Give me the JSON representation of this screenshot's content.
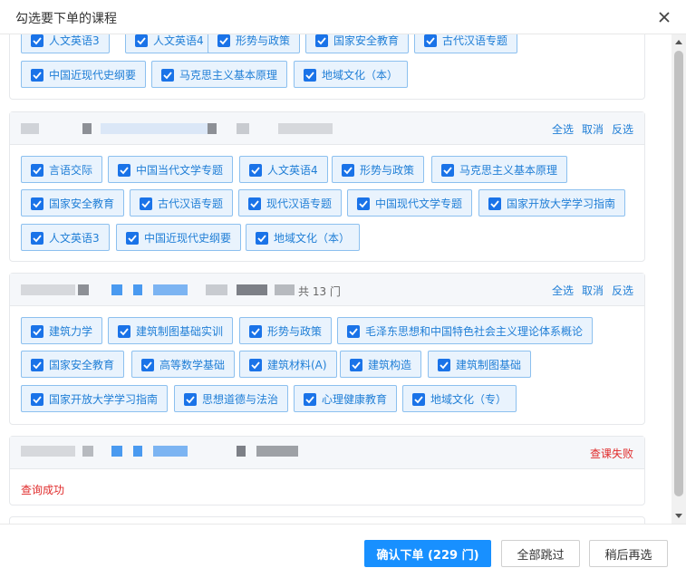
{
  "dialog": {
    "title": "勾选要下单的课程",
    "close_icon": "close-icon"
  },
  "section1": {
    "chips": [
      "人文英语3",
      "人文英语4",
      "形势与政策",
      "国家安全教育",
      "古代汉语专题",
      "中国近现代史纲要",
      "马克思主义基本原理",
      "地域文化（本）"
    ]
  },
  "section2": {
    "actions": {
      "select_all": "全选",
      "cancel": "取消",
      "invert": "反选"
    },
    "chips": [
      "言语交际",
      "中国当代文学专题",
      "人文英语4",
      "形势与政策",
      "马克思主义基本原理",
      "国家安全教育",
      "古代汉语专题",
      "现代汉语专题",
      "中国现代文学专题",
      "国家开放大学学习指南",
      "人文英语3",
      "中国近现代史纲要",
      "地域文化（本）"
    ]
  },
  "section3": {
    "count": "共 13 门",
    "actions": {
      "select_all": "全选",
      "cancel": "取消",
      "invert": "反选"
    },
    "chips": [
      "建筑力学",
      "建筑制图基础实训",
      "形势与政策",
      "毛泽东思想和中国特色社会主义理论体系概论",
      "国家安全教育",
      "高等数学基础",
      "建筑材料(A)",
      "建筑构造",
      "建筑制图基础",
      "国家开放大学学习指南",
      "思想道德与法治",
      "心理健康教育",
      "地域文化（专）"
    ]
  },
  "section4": {
    "status": "查课失败",
    "message": "查询成功"
  },
  "footer": {
    "confirm": "确认下单 (229 门)",
    "skip_all": "全部跳过",
    "later": "稍后再选"
  },
  "colors": {
    "accent": "#1890ff",
    "chip_bg": "#e9f3fd",
    "chip_border": "#8cc0ef",
    "link": "#1f7ed6",
    "error": "#e02b2b"
  }
}
